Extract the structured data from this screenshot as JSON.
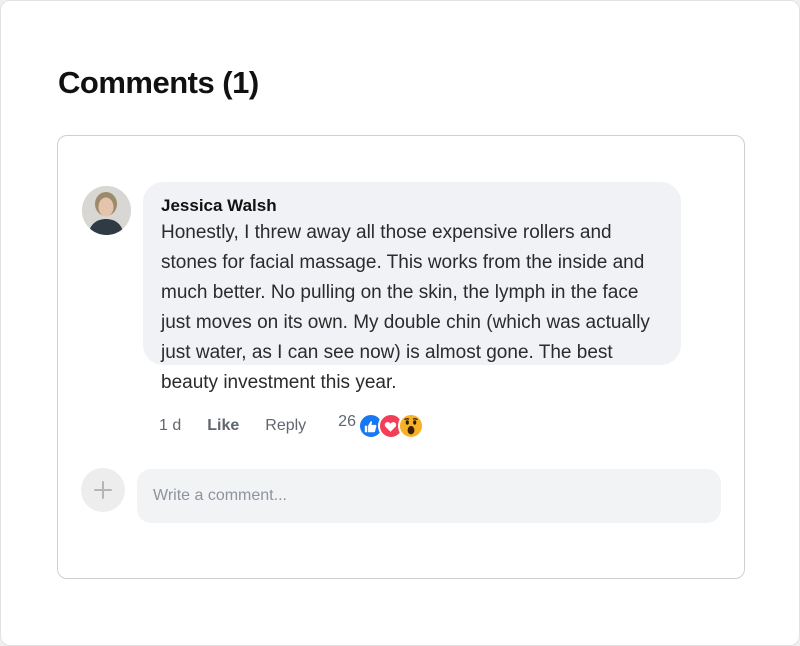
{
  "heading": "Comments (1)",
  "comment": {
    "author": "Jessica Walsh",
    "text": "Honestly, I threw away all those expensive rollers and stones for facial massage. This works from the inside and much better. No pulling on the skin, the lymph in the face just moves on its own. My double chin (which was actually just water, as I can see now) is almost gone. The best beauty investment this year.",
    "time": "1 d",
    "like_label": "Like",
    "reply_label": "Reply",
    "reaction_count": "26",
    "reactions": [
      "like-icon",
      "love-icon",
      "wow-icon"
    ]
  },
  "compose": {
    "placeholder": "Write a comment...",
    "avatar_icon": "plus-icon"
  },
  "colors": {
    "like": "#1877f2",
    "love": "#f33e58",
    "wow": "#f7b125",
    "bubble": "#f0f2f5"
  }
}
